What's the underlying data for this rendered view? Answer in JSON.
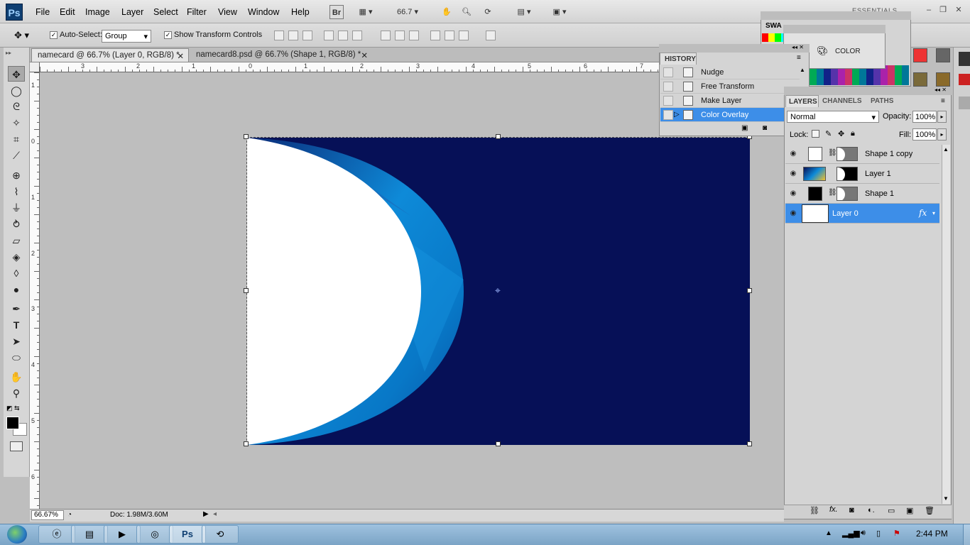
{
  "app": {
    "logo": "Ps"
  },
  "menu": [
    "File",
    "Edit",
    "Image",
    "Layer",
    "Select",
    "Filter",
    "View",
    "Window",
    "Help"
  ],
  "toolbar": {
    "bridge": "Br",
    "zoom": "66.7",
    "workspace": "ESSENTIALS"
  },
  "options": {
    "auto_select_label": "Auto-Select:",
    "auto_select_value": "Group",
    "show_transform_label": "Show Transform Controls"
  },
  "tabs": [
    {
      "label": "namecard @ 66.7% (Layer 0, RGB/8) *",
      "active": true
    },
    {
      "label": "namecard8.psd @ 66.7% (Shape 1, RGB/8) *",
      "active": false
    }
  ],
  "ruler_top": [
    "3",
    "2",
    "1",
    "0",
    "1",
    "2",
    "3",
    "4",
    "5",
    "6",
    "7"
  ],
  "ruler_left": [
    "1",
    "0",
    "1",
    "2",
    "3",
    "4",
    "5",
    "6"
  ],
  "history": {
    "title": "HISTORY",
    "items": [
      "Nudge",
      "Free Transform",
      "Make Layer",
      "Color Overlay"
    ],
    "selected": "Color Overlay"
  },
  "swatches_title": "SWA",
  "color_panel": "COLOR",
  "layers_panel": {
    "tabs": [
      "LAYERS",
      "CHANNELS",
      "PATHS"
    ],
    "blend_mode": "Normal",
    "opacity_label": "Opacity:",
    "opacity": "100%",
    "lock_label": "Lock:",
    "fill_label": "Fill:",
    "fill": "100%",
    "layers": [
      {
        "name": "Shape 1 copy",
        "selected": false
      },
      {
        "name": "Layer 1",
        "selected": false
      },
      {
        "name": "Shape 1",
        "selected": false
      },
      {
        "name": "Layer 0",
        "selected": true,
        "fx": "fx"
      }
    ]
  },
  "status": {
    "zoom": "66.67%",
    "doc": "Doc: 1.98M/3.60M"
  },
  "taskbar": {
    "clock": "2:44 PM"
  },
  "colors": {
    "canvas_navy": "#061057",
    "selection_blue": "#3d8ee8",
    "accent_light": "#1a9be6"
  }
}
